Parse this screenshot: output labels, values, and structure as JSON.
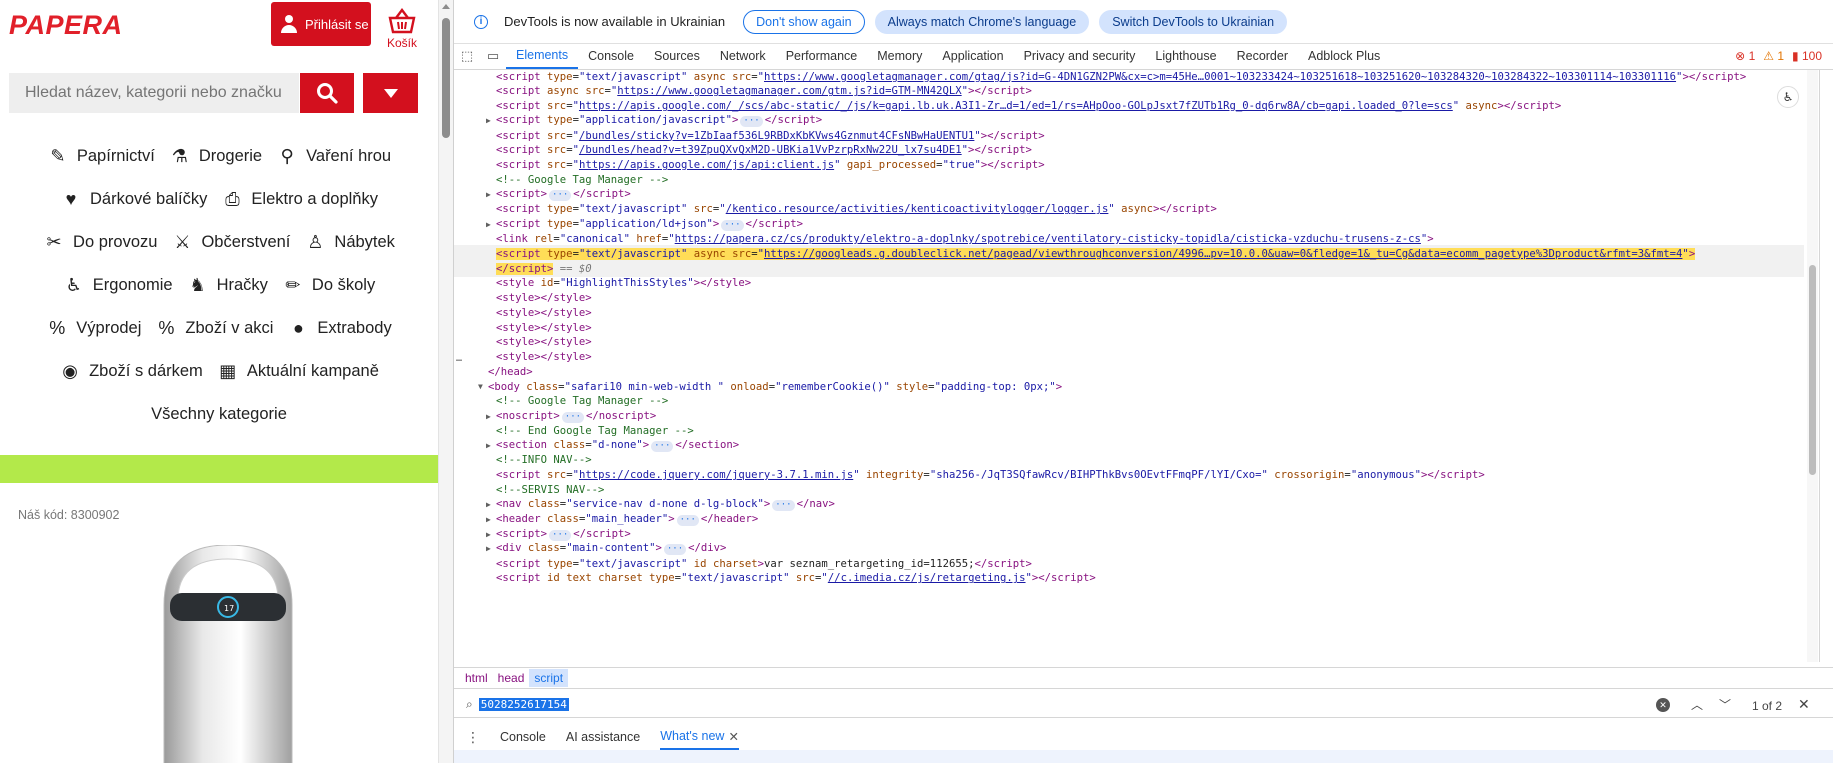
{
  "shop": {
    "logo": "PAPERA",
    "login_label": "Přihlásit se",
    "cart_label": "Košík",
    "search_placeholder": "Hledat název, kategorii nebo značku",
    "categories": [
      [
        "Papírnictví",
        "Drogerie",
        "Vaření hrou"
      ],
      [
        "Dárkové balíčky",
        "Elektro a doplňky"
      ],
      [
        "Do provozu",
        "Občerstvení",
        "Nábytek"
      ],
      [
        "Ergonomie",
        "Hračky",
        "Do školy"
      ],
      [
        "Výprodej",
        "Zboží v akci",
        "Extrabody"
      ],
      [
        "Zboží s dárkem",
        "Aktuální kampaně"
      ]
    ],
    "all_categories": "Všechny kategorie",
    "product_code": "Náš kód: 8300902",
    "accent_color": "#d3101e",
    "green_color": "#b3e94a"
  },
  "devtools": {
    "info_text": "DevTools is now available in Ukrainian",
    "btn_dont_show": "Don't show again",
    "btn_match_lang": "Always match Chrome's language",
    "btn_switch": "Switch DevTools to Ukrainian",
    "tabs": [
      "Elements",
      "Console",
      "Sources",
      "Network",
      "Performance",
      "Memory",
      "Application",
      "Privacy and security",
      "Lighthouse",
      "Recorder",
      "Adblock Plus"
    ],
    "active_tab": "Elements",
    "status": {
      "errors": "1",
      "warnings": "1",
      "issues": "100"
    },
    "breadcrumbs": [
      "html",
      "head",
      "script"
    ],
    "find": {
      "value": "5028252617154",
      "count": "1 of 2"
    },
    "drawer_tabs": [
      "Console",
      "AI assistance",
      "What's new"
    ],
    "lines": [
      {
        "indent": 0,
        "html": "<span class='tag'>&lt;script</span> <span class='attr'>type</span>=<span class='val'>\"text/javascript\"</span> <span class='attr'>async</span> <span class='attr'>src</span>=<span class='val'>\"</span><span class='link'>https://www.googletagmanager.com/gtag/js?id=G-4DN1GZN2PW&cx=c&gtm=45He…0001~103233424~103251618~103251620~103284320~103284322~103301114~103301116</span><span class='val'>\"</span><span class='tag'>&gt;&lt;/script&gt;</span>"
      },
      {
        "indent": 0,
        "html": "<span class='tag'>&lt;script</span> <span class='attr'>async</span> <span class='attr'>src</span>=<span class='val'>\"</span><span class='link'>https://www.googletagmanager.com/gtm.js?id=GTM-MN42QLX</span><span class='val'>\"</span><span class='tag'>&gt;&lt;/script&gt;</span>"
      },
      {
        "indent": 0,
        "html": "<span class='tag'>&lt;script</span> <span class='attr'>src</span>=<span class='val'>\"</span><span class='link'>https://apis.google.com/_/scs/abc-static/_/js/k=gapi.lb.uk.A3I1-Zr…d=1/ed=1/rs=AHpOoo-GOLpJsxt7fZUTb1Rg_0-dq6rw8A/cb=gapi.loaded_0?le=scs</span><span class='val'>\"</span> <span class='attr'>async</span><span class='tag'>&gt;&lt;/script&gt;</span>"
      },
      {
        "indent": 0,
        "tri": "▶",
        "html": "<span class='tag'>&lt;script</span> <span class='attr'>type</span>=<span class='val'>\"application/javascript\"</span><span class='tag'>&gt;</span><span class='dots'>···</span><span class='tag'>&lt;/script&gt;</span>"
      },
      {
        "indent": 0,
        "html": "<span class='tag'>&lt;script</span> <span class='attr'>src</span>=<span class='val'>\"</span><span class='link'>/bundles/sticky?v=1ZbIaaf536L9RBDxKbKVws4Gznmut4CFsNBwHaUENTU1</span><span class='val'>\"</span><span class='tag'>&gt;&lt;/script&gt;</span>"
      },
      {
        "indent": 0,
        "html": "<span class='tag'>&lt;script</span> <span class='attr'>src</span>=<span class='val'>\"</span><span class='link'>/bundles/head?v=t39ZpuQXvQxM2D-UBKia1VvPzrpRxNw22U_lx7su4DE1</span><span class='val'>\"</span><span class='tag'>&gt;&lt;/script&gt;</span>"
      },
      {
        "indent": 0,
        "html": "<span class='tag'>&lt;script</span> <span class='attr'>src</span>=<span class='val'>\"</span><span class='link'>https://apis.google.com/js/api:client.js</span><span class='val'>\"</span> <span class='attr'>gapi_processed</span>=<span class='val'>\"true\"</span><span class='tag'>&gt;&lt;/script&gt;</span>"
      },
      {
        "indent": 0,
        "html": "<span class='cmt'>&lt;!-- Google Tag Manager --&gt;</span>"
      },
      {
        "indent": 0,
        "tri": "▶",
        "html": "<span class='tag'>&lt;script&gt;</span><span class='dots'>···</span><span class='tag'>&lt;/script&gt;</span>"
      },
      {
        "indent": 0,
        "html": "<span class='tag'>&lt;script</span> <span class='attr'>type</span>=<span class='val'>\"text/javascript\"</span> <span class='attr'>src</span>=<span class='val'>\"</span><span class='link'>/kentico.resource/activities/kenticoactivitylogger/logger.js</span><span class='val'>\"</span> <span class='attr'>async</span><span class='tag'>&gt;&lt;/script&gt;</span>"
      },
      {
        "indent": 0,
        "tri": "▶",
        "html": "<span class='tag'>&lt;script</span> <span class='attr'>type</span>=<span class='val'>\"application/ld+json\"</span><span class='tag'>&gt;</span><span class='dots'>···</span><span class='tag'>&lt;/script&gt;</span>"
      },
      {
        "indent": 0,
        "html": "<span class='tag'>&lt;link</span> <span class='attr'>rel</span>=<span class='val'>\"canonical\"</span> <span class='attr'>href</span>=<span class='val'>\"</span><span class='link'>https://papera.cz/cs/produkty/elektro-a-doplnky/spotrebice/ventilatory-cisticky-topidla/cisticka-vzduchu-trusens-z-cs</span><span class='val'>\"</span><span class='tag'>&gt;</span>"
      },
      {
        "indent": 0,
        "hl": true,
        "html": "<span class='sel'><span class='tag'>&lt;script</span> <span class='attr'>type</span>=<span class='val'>\"text/javascript\"</span> <span class='attr'>async</span> <span class='attr'>src</span>=<span class='val'>\"</span><span class='link'>https://googleads.g.doubleclick.net/pagead/viewthroughconversion/4996…pv=10.0.0&uaw=0&fledge=1&_tu=Cg&data=ecomm_pagetype%3Dproduct&rfmt=3&fmt=4</span><span class='val'>\"</span><span class='tag'>&gt;</span></span>"
      },
      {
        "indent": 0,
        "hl": true,
        "html": "<span class='sel'><span class='tag'>&lt;/script&gt;</span></span> <span class='eq'>== $0</span>"
      },
      {
        "indent": 0,
        "html": "<span class='tag'>&lt;style</span> <span class='attr'>id</span>=<span class='val'>\"HighlightThisStyles\"</span><span class='tag'>&gt;&lt;/style&gt;</span>"
      },
      {
        "indent": 0,
        "html": "<span class='tag'>&lt;style&gt;&lt;/style&gt;</span>"
      },
      {
        "indent": 0,
        "html": "<span class='tag'>&lt;style&gt;&lt;/style&gt;</span>"
      },
      {
        "indent": 0,
        "html": "<span class='tag'>&lt;style&gt;&lt;/style&gt;</span>"
      },
      {
        "indent": 0,
        "html": "<span class='tag'>&lt;style&gt;&lt;/style&gt;</span>"
      },
      {
        "indent": 0,
        "html": "<span class='tag'>&lt;style&gt;&lt;/style&gt;</span>"
      },
      {
        "indent": -1,
        "html": "<span class='tag'>&lt;/head&gt;</span>"
      },
      {
        "indent": -1,
        "tri": "▼",
        "html": "<span class='tag'>&lt;body</span> <span class='attr'>class</span>=<span class='val'>\"safari10 min-web-width \"</span> <span class='attr'>onload</span>=<span class='val'>\"rememberCookie()\"</span> <span class='attr'>style</span>=<span class='val'>\"padding-top: 0px;\"</span><span class='tag'>&gt;</span>"
      },
      {
        "indent": 0,
        "html": "<span class='cmt'>&lt;!-- Google Tag Manager --&gt;</span>"
      },
      {
        "indent": 0,
        "tri": "▶",
        "html": "<span class='tag'>&lt;noscript&gt;</span><span class='dots'>···</span><span class='tag'>&lt;/noscript&gt;</span>"
      },
      {
        "indent": 0,
        "html": "<span class='cmt'>&lt;!-- End Google Tag Manager --&gt;</span>"
      },
      {
        "indent": 0,
        "tri": "▶",
        "html": "<span class='tag'>&lt;section</span> <span class='attr'>class</span>=<span class='val'>\"d-none\"</span><span class='tag'>&gt;</span><span class='dots'>···</span><span class='tag'>&lt;/section&gt;</span>"
      },
      {
        "indent": 0,
        "html": "<span class='cmt'>&lt;!--INFO NAV--&gt;</span>"
      },
      {
        "indent": 0,
        "html": "<span class='tag'>&lt;script</span> <span class='attr'>src</span>=<span class='val'>\"</span><span class='link'>https://code.jquery.com/jquery-3.7.1.min.js</span><span class='val'>\"</span> <span class='attr'>integrity</span>=<span class='val'>\"sha256-/JqT3SQfawRcv/BIHPThkBvs0OEvtFFmqPF/lYI/Cxo=\"</span> <span class='attr'>crossorigin</span>=<span class='val'>\"anonymous\"</span><span class='tag'>&gt;&lt;/script&gt;</span>"
      },
      {
        "indent": 0,
        "html": "<span class='cmt'>&lt;!--SERVIS NAV--&gt;</span>"
      },
      {
        "indent": 0,
        "tri": "▶",
        "html": "<span class='tag'>&lt;nav</span> <span class='attr'>class</span>=<span class='val'>\"service-nav d-none d-lg-block\"</span><span class='tag'>&gt;</span><span class='dots'>···</span><span class='tag'>&lt;/nav&gt;</span>"
      },
      {
        "indent": 0,
        "tri": "▶",
        "html": "<span class='tag'>&lt;header</span> <span class='attr'>class</span>=<span class='val'>\"main_header\"</span><span class='tag'>&gt;</span><span class='dots'>···</span><span class='tag'>&lt;/header&gt;</span>"
      },
      {
        "indent": 0,
        "tri": "▶",
        "html": "<span class='tag'>&lt;script&gt;</span><span class='dots'>···</span><span class='tag'>&lt;/script&gt;</span>"
      },
      {
        "indent": 0,
        "tri": "▶",
        "html": "<span class='tag'>&lt;div</span> <span class='attr'>class</span>=<span class='val'>\"main-content\"</span><span class='tag'>&gt;</span><span class='dots'>···</span><span class='tag'>&lt;/div&gt;</span>"
      },
      {
        "indent": 0,
        "html": "<span class='tag'>&lt;script</span> <span class='attr'>type</span>=<span class='val'>\"text/javascript\"</span> <span class='attr'>id</span> <span class='attr'>charset</span><span class='tag'>&gt;</span><span class='txt'>var seznam_retargeting_id=112655;</span><span class='tag'>&lt;/script&gt;</span>"
      },
      {
        "indent": 0,
        "html": "<span class='tag'>&lt;script</span> <span class='attr'>id</span> <span class='attr'>text</span> <span class='attr'>charset</span> <span class='attr'>type</span>=<span class='val'>\"text/javascript\"</span> <span class='attr'>src</span>=<span class='val'>\"</span><span class='link'>//c.imedia.cz/js/retargeting.js</span><span class='val'>\"</span><span class='tag'>&gt;&lt;/script&gt;</span>"
      }
    ]
  }
}
